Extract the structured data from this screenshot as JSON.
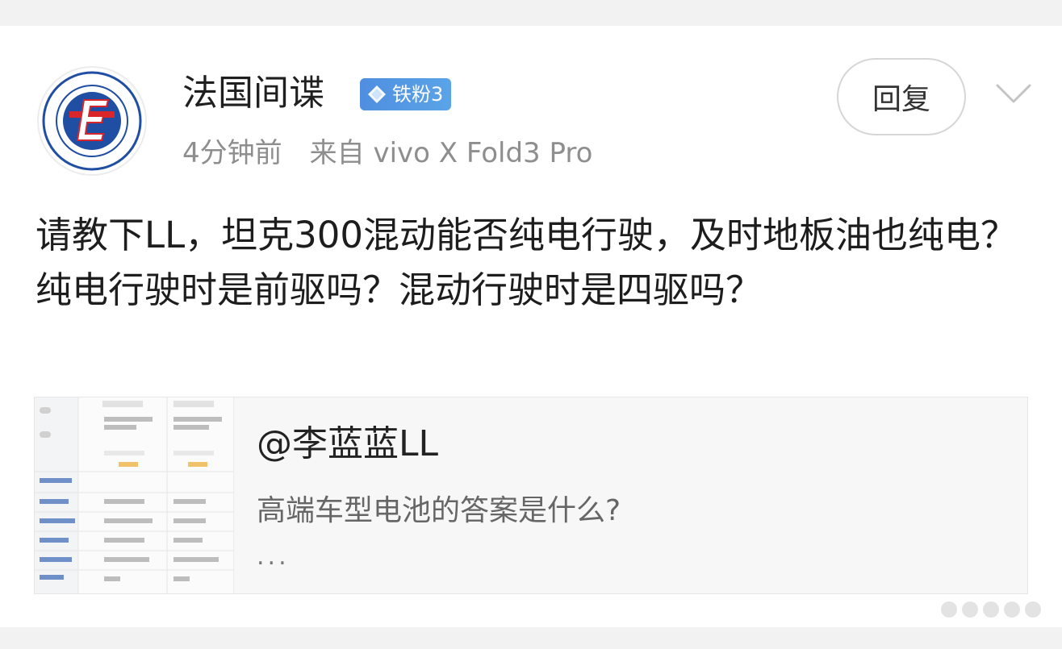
{
  "author": {
    "name": "法国间谍",
    "badge": "铁粉3",
    "time": "4分钟前",
    "source": "来自 vivo X Fold3 Pro"
  },
  "actions": {
    "reply_label": "回复"
  },
  "post": {
    "text": "请教下LL，坦克300混动能否纯电行驶，及时地板油也纯电？纯电行驶时是前驱吗？混动行驶时是四驱吗？"
  },
  "quoted": {
    "handle": "@李蓝蓝LL",
    "text": "高端车型电池的答案是什么?",
    "more": "..."
  },
  "colors": {
    "badge": "#4f8ee0",
    "logo_blue": "#1f4ea3",
    "logo_red": "#d9262b"
  },
  "icons": {
    "badge": "diamond-icon",
    "menu": "chevron-down-icon"
  }
}
